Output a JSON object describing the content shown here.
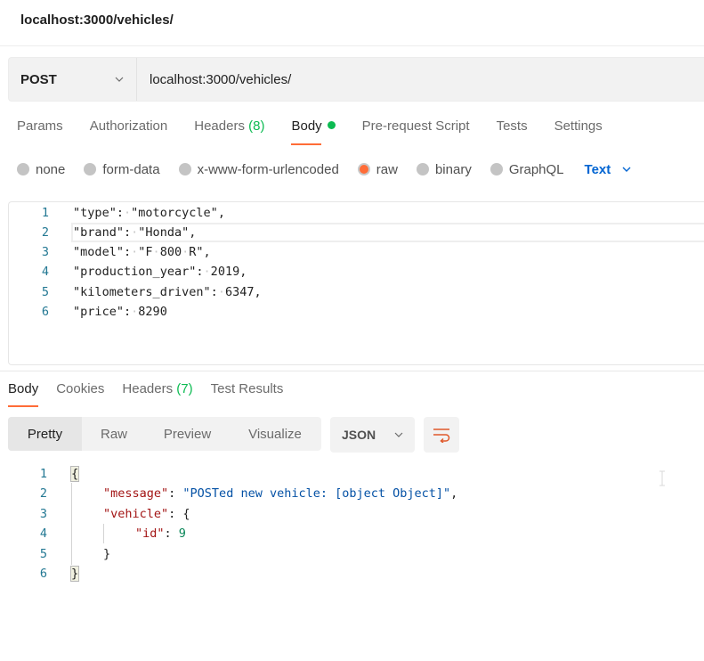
{
  "window": {
    "title": "localhost:3000/vehicles/"
  },
  "request": {
    "method": "POST",
    "url": "localhost:3000/vehicles/",
    "tabs": [
      {
        "label": "Params"
      },
      {
        "label": "Authorization"
      },
      {
        "label": "Headers",
        "count": "(8)"
      },
      {
        "label": "Body",
        "active": true,
        "indicator": "green-dot"
      },
      {
        "label": "Pre-request Script"
      },
      {
        "label": "Tests"
      },
      {
        "label": "Settings"
      }
    ],
    "body_types": [
      {
        "label": "none",
        "selected": false
      },
      {
        "label": "form-data",
        "selected": false
      },
      {
        "label": "x-www-form-urlencoded",
        "selected": false
      },
      {
        "label": "raw",
        "selected": true
      },
      {
        "label": "binary",
        "selected": false
      },
      {
        "label": "GraphQL",
        "selected": false
      }
    ],
    "raw_format": "Text",
    "body_lines": [
      {
        "num": "1",
        "text": "\"type\":·\"motorcycle\","
      },
      {
        "num": "2",
        "text": "\"brand\":·\"Honda\","
      },
      {
        "num": "3",
        "text": "\"model\":·\"F·800·R\","
      },
      {
        "num": "4",
        "text": "\"production_year\":·2019,"
      },
      {
        "num": "5",
        "text": "\"kilometers_driven\":·6347,"
      },
      {
        "num": "6",
        "text": "\"price\":·8290"
      }
    ]
  },
  "response": {
    "tabs": [
      {
        "label": "Body",
        "active": true
      },
      {
        "label": "Cookies"
      },
      {
        "label": "Headers",
        "count": "(7)"
      },
      {
        "label": "Test Results"
      }
    ],
    "view_modes": [
      {
        "label": "Pretty",
        "active": true
      },
      {
        "label": "Raw"
      },
      {
        "label": "Preview"
      },
      {
        "label": "Visualize"
      }
    ],
    "format": "JSON",
    "wrap_icon": "wrap-lines-icon",
    "line_numbers": [
      "1",
      "2",
      "3",
      "4",
      "5",
      "6"
    ],
    "json": {
      "open_brace": "{",
      "close_brace": "}",
      "message_key": "\"message\"",
      "message_value": "\"POSTed new vehicle: [object Object]\"",
      "vehicle_key": "\"vehicle\"",
      "id_key": "\"id\"",
      "id_value": "9"
    }
  },
  "colors": {
    "accent": "#ff6c37",
    "success": "#0cbb52",
    "link": "#0265d2"
  }
}
